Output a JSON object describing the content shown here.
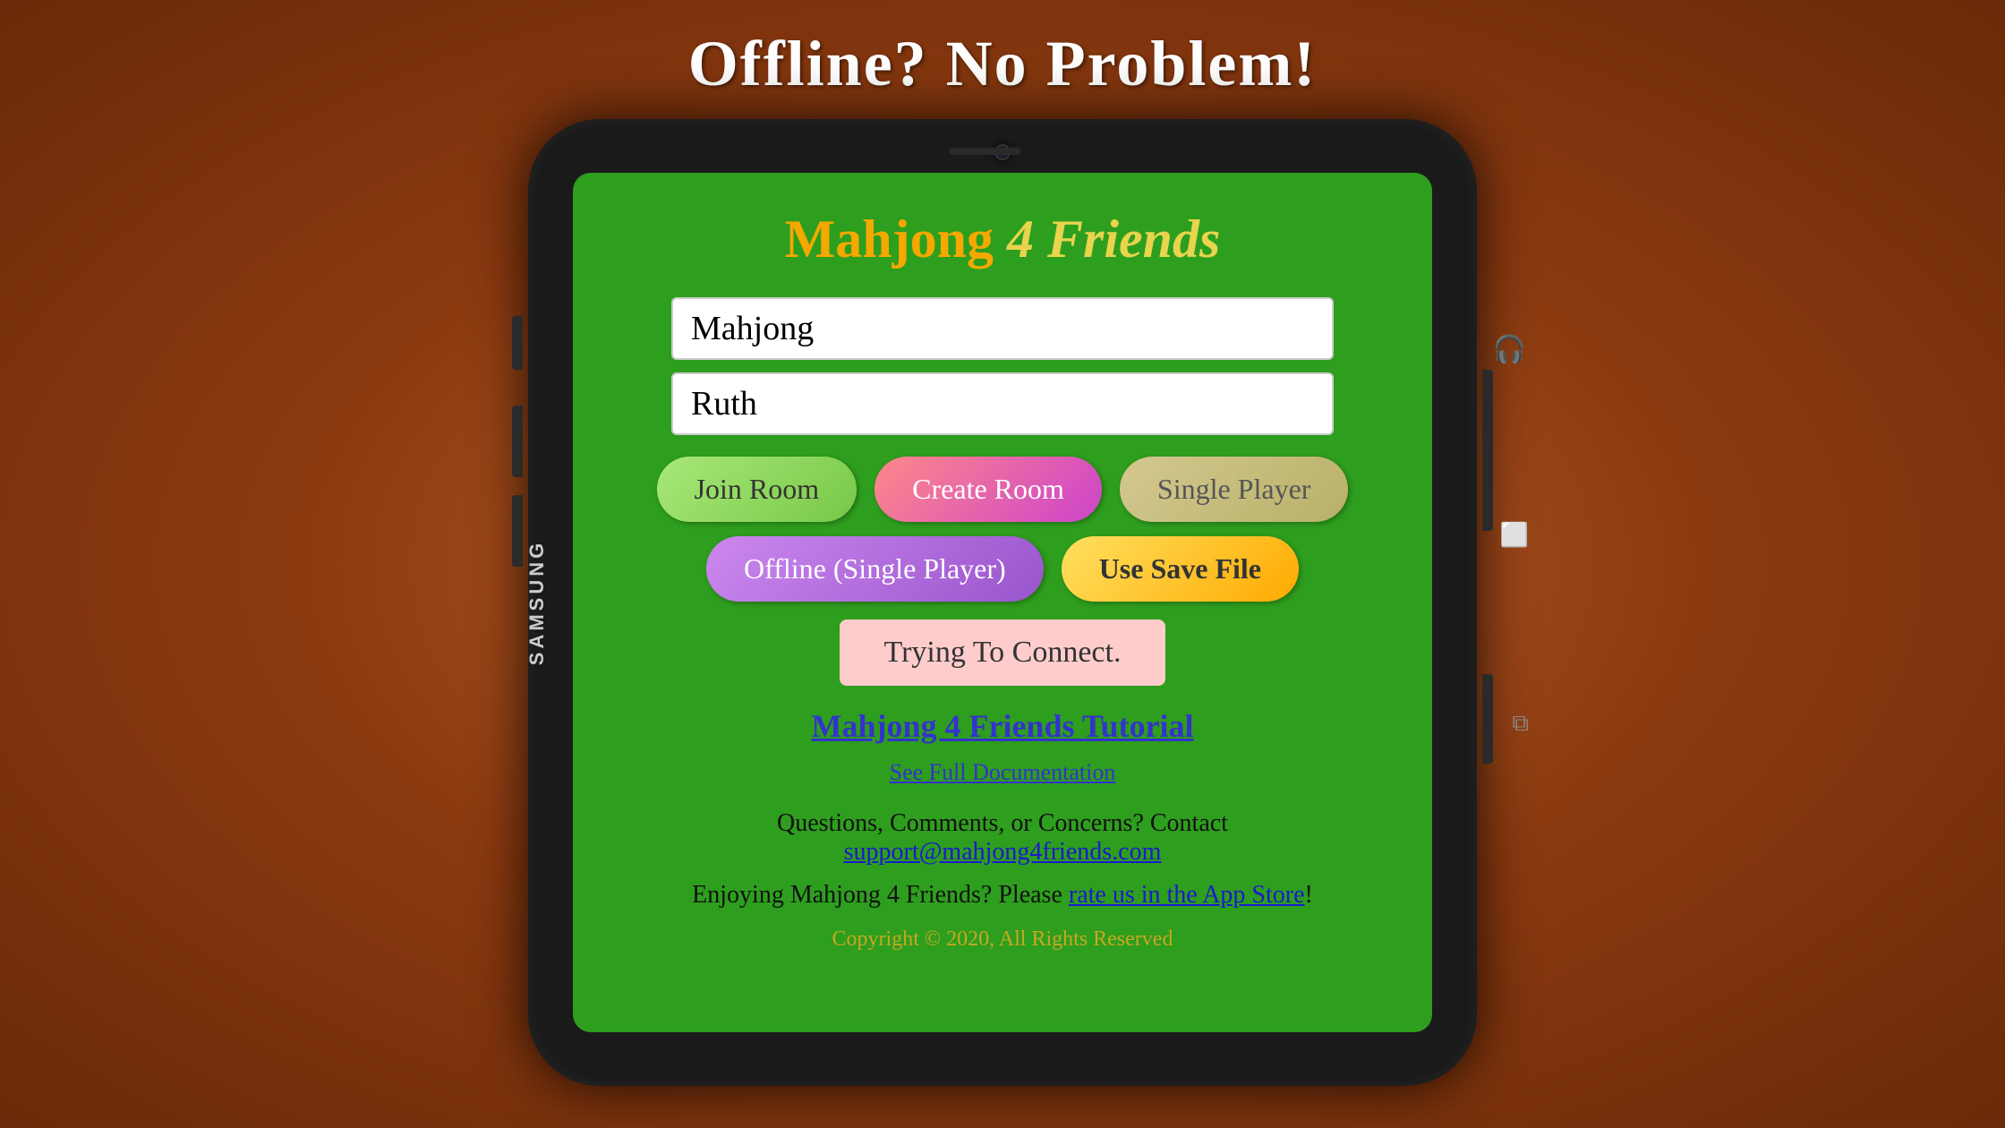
{
  "page": {
    "title": "Offline? No Problem!",
    "background": "#c0622a"
  },
  "app": {
    "title_part1": "Mahjong ",
    "title_part2": "4 Friends"
  },
  "inputs": {
    "field1_value": "Mahjong",
    "field1_placeholder": "Mahjong",
    "field2_value": "Ruth",
    "field2_placeholder": "Ruth"
  },
  "buttons": {
    "join_room": "Join Room",
    "create_room": "Create Room",
    "single_player": "Single Player",
    "offline_single_player": "Offline (Single Player)",
    "use_save_file": "Use Save File"
  },
  "status": {
    "connecting": "Trying To Connect."
  },
  "links": {
    "tutorial": "Mahjong 4 Friends Tutorial",
    "docs": "See Full Documentation",
    "contact_prefix": "Questions, Comments, or Concerns? Contact ",
    "contact_email": "support@mahjong4friends.com",
    "rate_prefix": "Enjoying Mahjong 4 Friends? Please ",
    "rate_link_text": "rate us in the App Store",
    "rate_suffix": "!"
  },
  "footer": {
    "copyright": "Copyright © 2020, All Rights Reserved"
  },
  "phone": {
    "brand": "SAMSUNG"
  }
}
